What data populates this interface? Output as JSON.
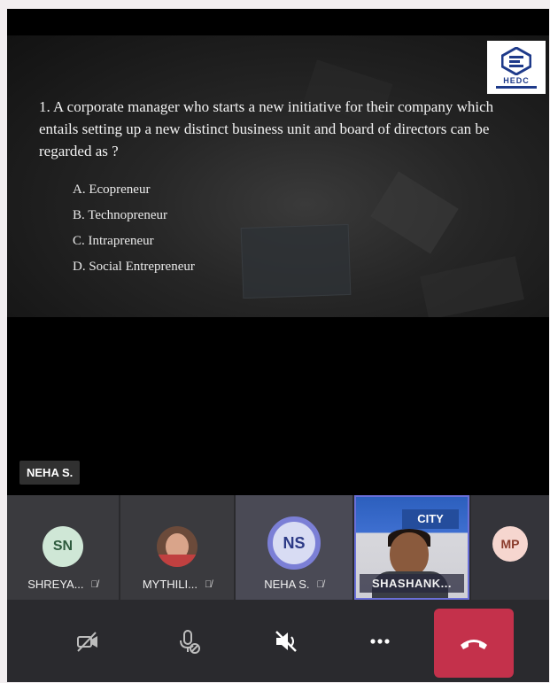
{
  "slide": {
    "logo_text": "HEDC",
    "question": "1. A corporate manager who starts a new initiative for their company which entails setting up a new distinct business unit and board of directors can be regarded as ?",
    "options": [
      "A. Ecopreneur",
      "B. Technopreneur",
      "C. Intrapreneur",
      "D. Social Entrepreneur"
    ]
  },
  "presenter": {
    "name_tag": "NEHA S."
  },
  "participants": [
    {
      "initials": "SN",
      "label": "SHREYA...",
      "muted": true
    },
    {
      "initials": "",
      "label": "MYTHILI...",
      "muted": true,
      "avatar": "photo"
    },
    {
      "initials": "NS",
      "label": "NEHA S.",
      "muted": true,
      "speaking": true
    },
    {
      "initials": "",
      "label": "SHASHANK...",
      "video": true,
      "video_sign": "CITY"
    },
    {
      "initials": "MP",
      "label": ""
    }
  ],
  "controls": {
    "camera": "camera-off-icon",
    "mic": "mic-off-icon",
    "speaker": "speaker-off-icon",
    "more": "more-icon",
    "end": "end-call-icon"
  },
  "colors": {
    "end_call": "#c4314b",
    "active_ring": "#7b7fd6",
    "logo": "#1e3a8a"
  }
}
